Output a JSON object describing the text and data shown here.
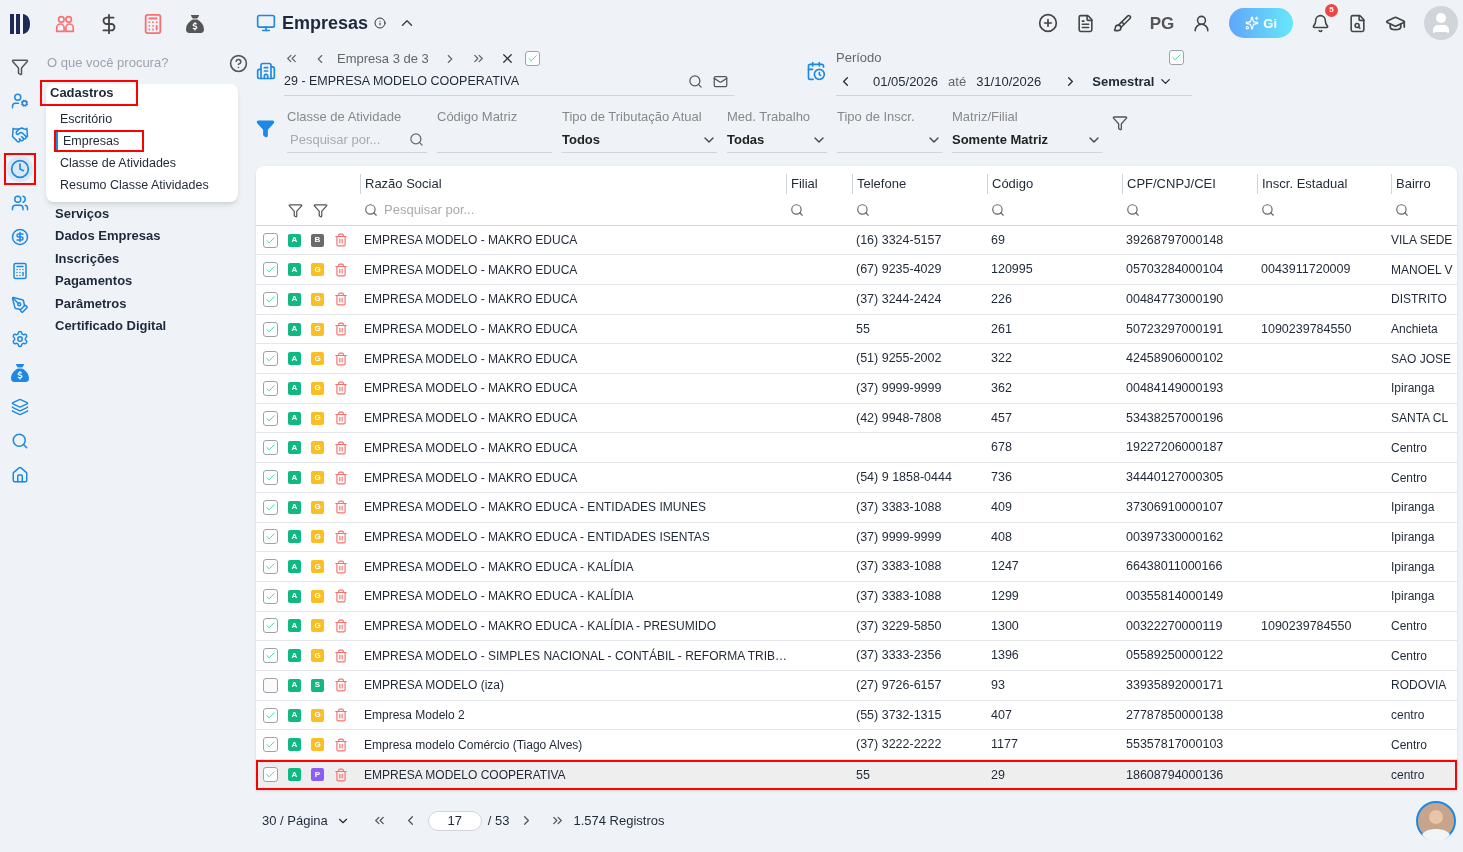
{
  "rail": [
    {
      "kind": "filter",
      "highlighted": false,
      "selected": false
    },
    {
      "kind": "user-gear",
      "highlighted": false,
      "selected": false
    },
    {
      "kind": "handshake",
      "highlighted": false,
      "selected": false
    },
    {
      "kind": "clock",
      "highlighted": true,
      "selected": true
    },
    {
      "kind": "users",
      "highlighted": false,
      "selected": false
    },
    {
      "kind": "dollar",
      "highlighted": false,
      "selected": false
    },
    {
      "kind": "calculator",
      "highlighted": false,
      "selected": false
    },
    {
      "kind": "pen",
      "highlighted": false,
      "selected": false
    },
    {
      "kind": "gear",
      "highlighted": false,
      "selected": false
    },
    {
      "kind": "bag",
      "highlighted": false,
      "selected": false
    },
    {
      "kind": "layers",
      "highlighted": false,
      "selected": false
    },
    {
      "kind": "search",
      "highlighted": false,
      "selected": false
    },
    {
      "kind": "home",
      "highlighted": false,
      "selected": false
    }
  ],
  "menu_search": {
    "placeholder": "O que você procura?"
  },
  "menu": [
    {
      "label": "Cadastros",
      "expanded": true,
      "highlighted": true,
      "children": [
        {
          "label": "Escritório",
          "selected": false,
          "highlighted": false
        },
        {
          "label": "Empresas",
          "selected": true,
          "highlighted": true
        },
        {
          "label": "Classe de Atividades",
          "selected": false,
          "highlighted": false
        },
        {
          "label": "Resumo Classe Atividades",
          "selected": false,
          "highlighted": false
        }
      ]
    },
    {
      "label": "Serviços",
      "expanded": false,
      "highlighted": false
    },
    {
      "label": "Dados Empresas",
      "expanded": false,
      "highlighted": false
    },
    {
      "label": "Inscrições",
      "expanded": false,
      "highlighted": false
    },
    {
      "label": "Pagamentos",
      "expanded": false,
      "highlighted": false
    },
    {
      "label": "Parâmetros",
      "expanded": false,
      "highlighted": false
    },
    {
      "label": "Certificado Digital",
      "expanded": false,
      "highlighted": false
    }
  ],
  "page_title": "Empresas",
  "header_actions": {
    "initials": "PG",
    "assistant": "Gi",
    "notifications": "5"
  },
  "company_nav": {
    "position": "Empresa 3 de 3",
    "checked": true,
    "company": "29 - EMPRESA MODELO COOPERATIVA"
  },
  "period": {
    "label": "Período",
    "start": "01/05/2026",
    "separator": "até",
    "end": "31/10/2026",
    "range": "Semestral",
    "checked": true
  },
  "filters": [
    {
      "kind": "search",
      "label": "Classe de Atividade",
      "placeholder": "Pesquisar por..."
    },
    {
      "kind": "text",
      "label": "Código Matriz"
    },
    {
      "kind": "select",
      "label": "Tipo de Tributação Atual",
      "value": "Todos"
    },
    {
      "kind": "select",
      "label": "Med. Trabalho",
      "value": "Todas"
    },
    {
      "kind": "select",
      "label": "Tipo de Inscr."
    },
    {
      "kind": "select",
      "label": "Matriz/Filial",
      "value": "Somente Matriz"
    }
  ],
  "table": {
    "columns": [
      "Razão Social",
      "Filial",
      "Telefone",
      "Código",
      "CPF/CNPJ/CEI",
      "Inscr. Estadual",
      "Bairro"
    ],
    "search_placeholder": "Pesquisar por...",
    "rows": [
      {
        "checked": true,
        "status": {
          "letter": "A",
          "color": "#10b981"
        },
        "type": {
          "letter": "B",
          "color": "#6b6b6b"
        },
        "razao": "EMPRESA MODELO - MAKRO EDUCA",
        "telefone": "(16) 3324-5157",
        "codigo": "69",
        "cpf": "39268797000148",
        "bairro": "VILA SEDE",
        "selected": false
      },
      {
        "checked": true,
        "status": {
          "letter": "A",
          "color": "#10b981"
        },
        "type": {
          "letter": "G",
          "color": "#fbbf24"
        },
        "razao": "EMPRESA MODELO - MAKRO EDUCA",
        "telefone": "(67) 9235-4029",
        "codigo": "120995",
        "cpf": "05703284000104",
        "inscr": "0043911720009",
        "bairro": "MANOEL V",
        "selected": false
      },
      {
        "checked": true,
        "status": {
          "letter": "A",
          "color": "#10b981"
        },
        "type": {
          "letter": "G",
          "color": "#fbbf24"
        },
        "razao": "EMPRESA MODELO - MAKRO EDUCA",
        "telefone": "(37) 3244-2424",
        "codigo": "226",
        "cpf": "00484773000190",
        "bairro": "DISTRITO",
        "selected": false
      },
      {
        "checked": true,
        "status": {
          "letter": "A",
          "color": "#10b981"
        },
        "type": {
          "letter": "G",
          "color": "#fbbf24"
        },
        "razao": "EMPRESA MODELO - MAKRO EDUCA",
        "telefone": "55",
        "codigo": "261",
        "cpf": "50723297000191",
        "inscr": "1090239784550",
        "bairro": "Anchieta",
        "selected": false
      },
      {
        "checked": true,
        "status": {
          "letter": "A",
          "color": "#10b981"
        },
        "type": {
          "letter": "G",
          "color": "#fbbf24"
        },
        "razao": "EMPRESA MODELO - MAKRO EDUCA",
        "telefone": "(51) 9255-2002",
        "codigo": "322",
        "cpf": "42458906000102",
        "bairro": "SAO JOSE",
        "selected": false
      },
      {
        "checked": true,
        "status": {
          "letter": "A",
          "color": "#10b981"
        },
        "type": {
          "letter": "G",
          "color": "#fbbf24"
        },
        "razao": "EMPRESA MODELO - MAKRO EDUCA",
        "telefone": "(37) 9999-9999",
        "codigo": "362",
        "cpf": "00484149000193",
        "bairro": "Ipiranga",
        "selected": false
      },
      {
        "checked": true,
        "status": {
          "letter": "A",
          "color": "#10b981"
        },
        "type": {
          "letter": "G",
          "color": "#fbbf24"
        },
        "razao": "EMPRESA MODELO - MAKRO EDUCA",
        "telefone": "(42) 9948-7808",
        "codigo": "457",
        "cpf": "53438257000196",
        "bairro": "SANTA CL",
        "selected": false
      },
      {
        "checked": true,
        "status": {
          "letter": "A",
          "color": "#10b981"
        },
        "type": {
          "letter": "G",
          "color": "#fbbf24"
        },
        "razao": "EMPRESA MODELO - MAKRO EDUCA",
        "codigo": "678",
        "cpf": "19227206000187",
        "bairro": "Centro",
        "selected": false
      },
      {
        "checked": true,
        "status": {
          "letter": "A",
          "color": "#10b981"
        },
        "type": {
          "letter": "G",
          "color": "#fbbf24"
        },
        "razao": "EMPRESA MODELO - MAKRO EDUCA",
        "telefone": "(54) 9 1858-0444",
        "codigo": "736",
        "cpf": "34440127000305",
        "bairro": "Centro",
        "selected": false
      },
      {
        "checked": true,
        "status": {
          "letter": "A",
          "color": "#10b981"
        },
        "type": {
          "letter": "G",
          "color": "#fbbf24"
        },
        "razao": "EMPRESA MODELO - MAKRO EDUCA - ENTIDADES IMUNES",
        "telefone": "(37) 3383-1088",
        "codigo": "409",
        "cpf": "37306910000107",
        "bairro": "Ipiranga",
        "selected": false
      },
      {
        "checked": true,
        "status": {
          "letter": "A",
          "color": "#10b981"
        },
        "type": {
          "letter": "G",
          "color": "#fbbf24"
        },
        "razao": "EMPRESA MODELO - MAKRO EDUCA - ENTIDADES ISENTAS",
        "telefone": "(37) 9999-9999",
        "codigo": "408",
        "cpf": "00397330000162",
        "bairro": "Ipiranga",
        "selected": false
      },
      {
        "checked": true,
        "status": {
          "letter": "A",
          "color": "#10b981"
        },
        "type": {
          "letter": "G",
          "color": "#fbbf24"
        },
        "razao": "EMPRESA MODELO - MAKRO EDUCA - KALÍDIA",
        "telefone": "(37) 3383-1088",
        "codigo": "1247",
        "cpf": "66438011000166",
        "bairro": "Ipiranga",
        "selected": false
      },
      {
        "checked": true,
        "status": {
          "letter": "A",
          "color": "#10b981"
        },
        "type": {
          "letter": "G",
          "color": "#fbbf24"
        },
        "razao": "EMPRESA MODELO - MAKRO EDUCA - KALÍDIA",
        "telefone": "(37) 3383-1088",
        "codigo": "1299",
        "cpf": "00355814000149",
        "bairro": "Ipiranga",
        "selected": false
      },
      {
        "checked": true,
        "status": {
          "letter": "A",
          "color": "#10b981"
        },
        "type": {
          "letter": "G",
          "color": "#fbbf24"
        },
        "razao": "EMPRESA MODELO - MAKRO EDUCA - KALÍDIA - PRESUMIDO",
        "telefone": "(37) 3229-5850",
        "codigo": "1300",
        "cpf": "00322270000119",
        "inscr": "1090239784550",
        "bairro": "Centro",
        "selected": false
      },
      {
        "checked": true,
        "status": {
          "letter": "A",
          "color": "#10b981"
        },
        "type": {
          "letter": "G",
          "color": "#fbbf24"
        },
        "razao": "EMPRESA MODELO - SIMPLES NACIONAL - CONTÁBIL - REFORMA TRIB…",
        "telefone": "(37) 3333-2356",
        "codigo": "1396",
        "cpf": "05589250000122",
        "bairro": "Centro",
        "selected": false
      },
      {
        "checked": false,
        "status": {
          "letter": "A",
          "color": "#10b981"
        },
        "type": {
          "letter": "S",
          "color": "#10b981"
        },
        "razao": "EMPRESA MODELO (iza)",
        "telefone": "(27) 9726-6157",
        "codigo": "93",
        "cpf": "33935892000171",
        "bairro": "RODOVIA",
        "selected": false
      },
      {
        "checked": true,
        "status": {
          "letter": "A",
          "color": "#10b981"
        },
        "type": {
          "letter": "G",
          "color": "#fbbf24"
        },
        "razao": "Empresa Modelo 2",
        "telefone": "(55) 3732-1315",
        "codigo": "407",
        "cpf": "27787850000138",
        "bairro": "centro",
        "selected": false
      },
      {
        "checked": true,
        "status": {
          "letter": "A",
          "color": "#10b981"
        },
        "type": {
          "letter": "G",
          "color": "#fbbf24"
        },
        "razao": "Empresa modelo Comércio (Tiago Alves)",
        "telefone": "(37) 3222-2222",
        "codigo": "1177",
        "cpf": "55357817000103",
        "bairro": "Centro",
        "selected": false
      },
      {
        "checked": true,
        "status": {
          "letter": "A",
          "color": "#10b981"
        },
        "type": {
          "letter": "P",
          "color": "#8b5cf6"
        },
        "razao": "EMPRESA MODELO COOPERATIVA",
        "telefone": "55",
        "codigo": "29",
        "cpf": "18608794000136",
        "bairro": "centro",
        "selected": true
      }
    ]
  },
  "pagination": {
    "page_size": "30 / Página",
    "page": "17",
    "total_pages": "/ 53",
    "records": "1.574 Registros"
  }
}
